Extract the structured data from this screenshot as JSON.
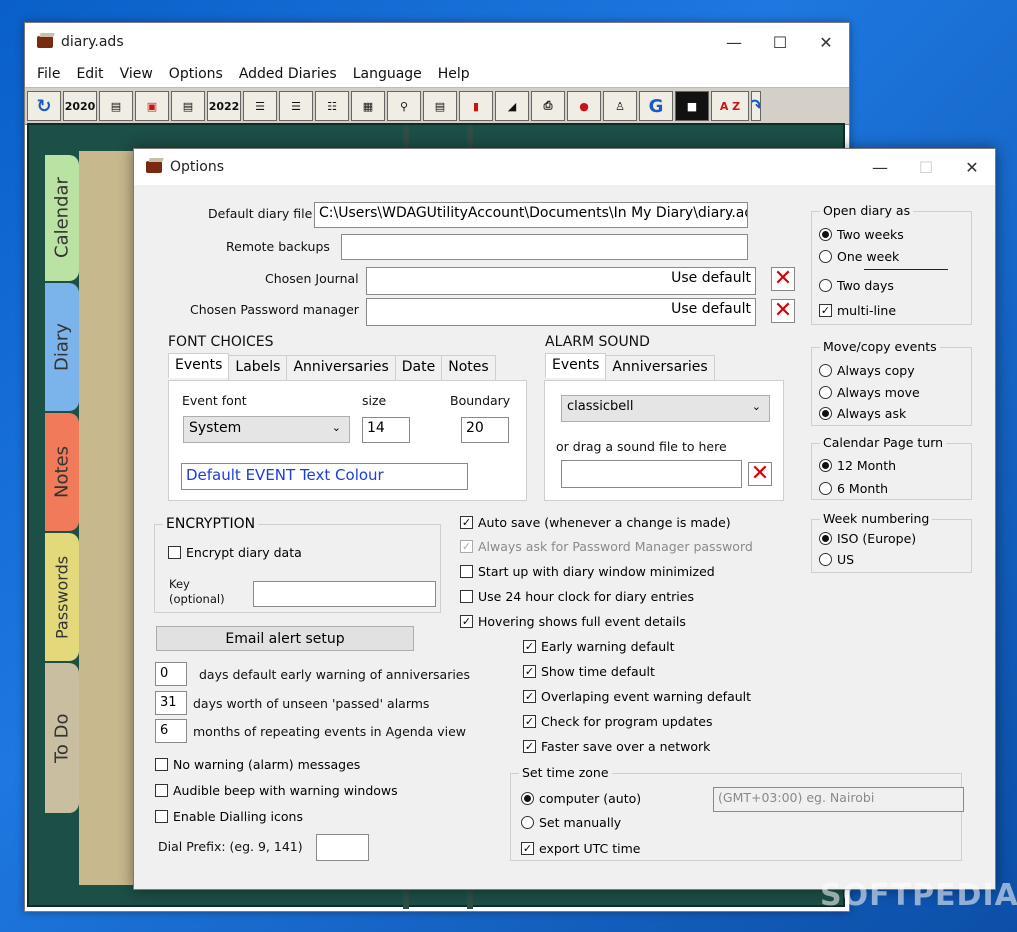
{
  "main": {
    "title": "diary.ads",
    "menu": [
      "File",
      "Edit",
      "View",
      "Options",
      "Added Diaries",
      "Language",
      "Help"
    ],
    "toolbar": {
      "year_prev": "2020",
      "year_next": "2022",
      "az": "A Z"
    },
    "side_tabs": [
      "Calendar",
      "Diary",
      "Notes",
      "Passwords",
      "To Do"
    ]
  },
  "dialog": {
    "title": "Options",
    "default_diary_file_label": "Default diary file",
    "default_diary_file_value": "C:\\Users\\WDAGUtilityAccount\\Documents\\In My Diary\\diary.ads",
    "remote_backups_label": "Remote backups",
    "remote_backups_value": "",
    "chosen_journal_label": "Chosen Journal",
    "chosen_journal_value": "Use default",
    "chosen_password_label": "Chosen Password manager",
    "chosen_password_value": "Use default",
    "font_choices": {
      "title": "FONT CHOICES",
      "tabs": [
        "Events",
        "Labels",
        "Anniversaries",
        "Date",
        "Notes"
      ],
      "event_font_label": "Event font",
      "event_font_value": "System",
      "size_label": "size",
      "size_value": "14",
      "boundary_label": "Boundary",
      "boundary_value": "20",
      "colour_label": "Default EVENT Text Colour"
    },
    "alarm_sound": {
      "title": "ALARM SOUND",
      "tabs": [
        "Events",
        "Anniversaries"
      ],
      "sound_value": "classicbell",
      "drag_label": "or drag a sound file to here"
    },
    "encryption": {
      "title": "ENCRYPTION",
      "encrypt_label": "Encrypt diary data",
      "key_label1": "Key",
      "key_label2": "(optional)"
    },
    "email_button": "Email alert setup",
    "numbers": [
      {
        "value": "0",
        "label": "days default early warning of anniversaries"
      },
      {
        "value": "31",
        "label": "days worth of unseen 'passed' alarms"
      },
      {
        "value": "6",
        "label": "months of repeating events in Agenda view"
      }
    ],
    "left_checks": [
      {
        "label": "No warning (alarm) messages",
        "checked": false
      },
      {
        "label": "Audible beep with warning windows",
        "checked": false
      },
      {
        "label": "Enable Dialling icons",
        "checked": false
      }
    ],
    "dial_prefix_label": "Dial Prefix: (eg. 9, 141)",
    "dial_prefix_value": "",
    "mid_checks": [
      {
        "label": "Auto save (whenever a change is made)",
        "checked": true,
        "disabled": false
      },
      {
        "label": "Always ask for Password Manager password",
        "checked": true,
        "disabled": true
      },
      {
        "label": "Start up with diary window minimized",
        "checked": false,
        "disabled": false
      },
      {
        "label": "Use 24 hour clock for diary entries",
        "checked": false,
        "disabled": false
      },
      {
        "label": "Hovering shows full event details",
        "checked": true,
        "disabled": false
      }
    ],
    "sub_checks": [
      {
        "label": "Early warning default",
        "checked": true
      },
      {
        "label": "Show time default",
        "checked": true
      },
      {
        "label": "Overlaping event warning default",
        "checked": true
      },
      {
        "label": "Check for program updates",
        "checked": true
      },
      {
        "label": "Faster save over a network",
        "checked": true
      }
    ],
    "timezone": {
      "title": "Set time zone",
      "computer_label": "computer (auto)",
      "manual_label": "Set manually",
      "utc_label": "export UTC time",
      "tz_value": "(GMT+03:00) eg. Nairobi"
    },
    "open_diary": {
      "title": "Open diary as",
      "opts": [
        "Two weeks",
        "One week",
        "Two days"
      ],
      "selected": 0,
      "multiline_label": "multi-line"
    },
    "move_copy": {
      "title": "Move/copy events",
      "opts": [
        "Always copy",
        "Always move",
        "Always ask"
      ],
      "selected": 2
    },
    "page_turn": {
      "title": "Calendar Page turn",
      "opts": [
        "12 Month",
        "6 Month"
      ],
      "selected": 0
    },
    "week_numbering": {
      "title": "Week numbering",
      "opts": [
        "ISO (Europe)",
        "US"
      ],
      "selected": 0
    }
  },
  "watermark": "SOFTPEDIA"
}
